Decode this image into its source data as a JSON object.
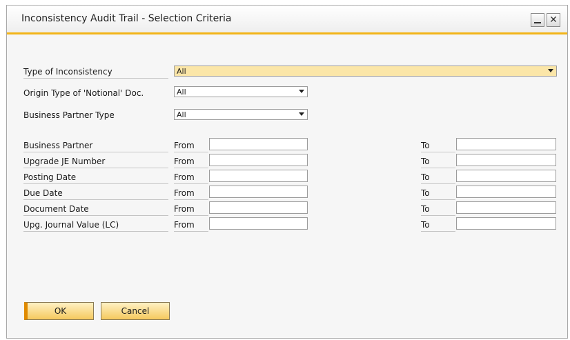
{
  "window": {
    "title": "Inconsistency Audit Trail - Selection Criteria",
    "minimize_icon": "minimize-icon",
    "close_icon": "close-icon",
    "close_glyph": "✕"
  },
  "criteria": {
    "type_of_inconsistency": {
      "label": "Type of Inconsistency",
      "value": "All"
    },
    "origin_type": {
      "label": "Origin Type of 'Notional' Doc.",
      "value": "All"
    },
    "bp_type": {
      "label": "Business Partner Type",
      "value": "All"
    }
  },
  "ranges": {
    "from_label": "From",
    "to_label": "To",
    "rows": [
      {
        "label": "Business Partner",
        "from": "",
        "to": ""
      },
      {
        "label": "Upgrade JE Number",
        "from": "",
        "to": ""
      },
      {
        "label": "Posting Date",
        "from": "",
        "to": ""
      },
      {
        "label": "Due Date",
        "from": "",
        "to": ""
      },
      {
        "label": "Document Date",
        "from": "",
        "to": ""
      },
      {
        "label": "Upg. Journal Value (LC)",
        "from": "",
        "to": ""
      }
    ]
  },
  "buttons": {
    "ok": "OK",
    "cancel": "Cancel"
  },
  "colors": {
    "accent": "#f2b418",
    "active_field": "#fbe6a8"
  }
}
